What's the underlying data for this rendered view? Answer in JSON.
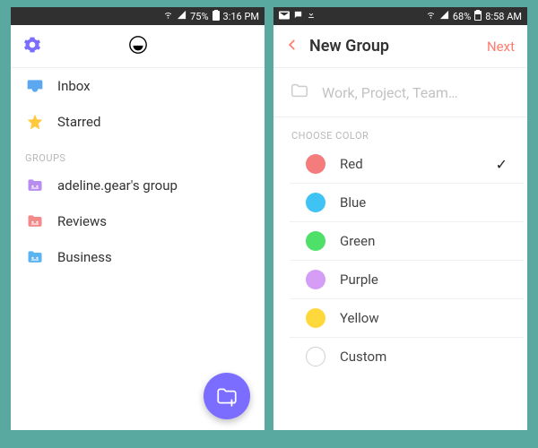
{
  "left": {
    "status": {
      "signal": "75%",
      "time": "3:16 PM"
    },
    "nav": {
      "inbox": "Inbox",
      "starred": "Starred"
    },
    "groups_label": "GROUPS",
    "groups": [
      {
        "label": "adeline.gear's group",
        "color": "#b98cf0"
      },
      {
        "label": "Reviews",
        "color": "#f28a8a"
      },
      {
        "label": "Business",
        "color": "#5bb3f0"
      }
    ]
  },
  "right": {
    "status": {
      "signal": "68%",
      "time": "8:58 AM"
    },
    "header": {
      "title": "New Group",
      "next": "Next"
    },
    "input_placeholder": "Work, Project, Team…",
    "choose_label": "CHOOSE COLOR",
    "colors": [
      {
        "name": "Red",
        "hex": "#f47c7c",
        "selected": true
      },
      {
        "name": "Blue",
        "hex": "#3fc3f5",
        "selected": false
      },
      {
        "name": "Green",
        "hex": "#4fe06a",
        "selected": false
      },
      {
        "name": "Purple",
        "hex": "#d49cf5",
        "selected": false
      },
      {
        "name": "Yellow",
        "hex": "#ffd93b",
        "selected": false
      },
      {
        "name": "Custom",
        "hex": "",
        "selected": false
      }
    ]
  }
}
